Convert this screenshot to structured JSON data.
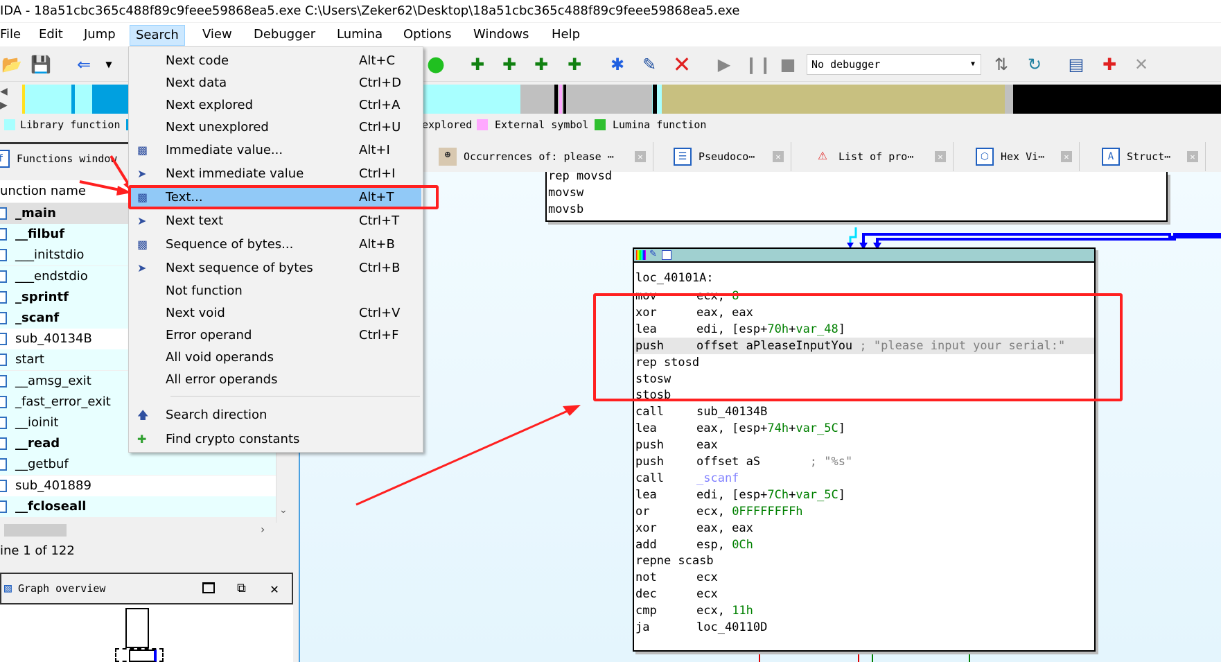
{
  "window": {
    "title": "IDA - 18a51cbc365c488f89c9feee59868ea5.exe C:\\Users\\Zeker62\\Desktop\\18a51cbc365c488f89c9feee59868ea5.exe"
  },
  "menubar": [
    "File",
    "Edit",
    "Jump",
    "Search",
    "View",
    "Debugger",
    "Lumina",
    "Options",
    "Windows",
    "Help"
  ],
  "toolbar": {
    "debugger_select": "No debugger"
  },
  "legend": {
    "library": "Library function",
    "unexplored": "explored",
    "external": "External symbol",
    "lumina": "Lumina function"
  },
  "colors": {
    "library": "#a8ffff",
    "regular": "#00a0e0",
    "external": "#ffa8ff",
    "lumina": "#30c030",
    "data": "#c8c080",
    "highlight_box": "#ff2020"
  },
  "tabs": {
    "functions": "Functions window",
    "occurrences": "Occurrences of: please ⋯",
    "pseudocode": "Pseudoco⋯",
    "problems": "List of pro⋯",
    "hexview": "Hex Vi⋯",
    "structures": "Struct⋯"
  },
  "functions": {
    "header": "unction name",
    "rows": [
      {
        "name": "_main",
        "bold": true
      },
      {
        "name": "__filbuf",
        "bold": true
      },
      {
        "name": "___initstdio",
        "bold": false
      },
      {
        "name": "___endstdio",
        "bold": false
      },
      {
        "name": "_sprintf",
        "bold": true
      },
      {
        "name": "_scanf",
        "bold": true
      },
      {
        "name": "sub_40134B",
        "bold": false
      },
      {
        "name": "start",
        "bold": false
      },
      {
        "name": "__amsg_exit",
        "bold": false
      },
      {
        "name": "_fast_error_exit",
        "bold": false
      },
      {
        "name": "__ioinit",
        "bold": false
      },
      {
        "name": "__read",
        "bold": true
      },
      {
        "name": "__getbuf",
        "bold": false
      },
      {
        "name": "sub_401889",
        "bold": false
      },
      {
        "name": "__fcloseall",
        "bold": true
      }
    ],
    "status": "ine 1 of 122"
  },
  "graph_overview": {
    "title": "Graph overview"
  },
  "search_menu": [
    {
      "label": "Next code",
      "shortcut": "Alt+C",
      "icon": ""
    },
    {
      "label": "Next data",
      "shortcut": "Ctrl+D",
      "icon": ""
    },
    {
      "label": "Next explored",
      "shortcut": "Ctrl+A",
      "icon": ""
    },
    {
      "label": "Next unexplored",
      "shortcut": "Ctrl+U",
      "icon": ""
    },
    {
      "label": "Immediate value...",
      "shortcut": "Alt+I",
      "icon": "binoculars-icon"
    },
    {
      "label": "Next immediate value",
      "shortcut": "Ctrl+I",
      "icon": "binoculars-next-icon"
    },
    {
      "label": "Text...",
      "shortcut": "Alt+T",
      "icon": "binoculars-text-icon"
    },
    {
      "label": "Next text",
      "shortcut": "Ctrl+T",
      "icon": "binoculars-next-icon"
    },
    {
      "label": "Sequence of bytes...",
      "shortcut": "Alt+B",
      "icon": "binoculars-bytes-icon"
    },
    {
      "label": "Next sequence of bytes",
      "shortcut": "Ctrl+B",
      "icon": "binoculars-next-icon"
    },
    {
      "label": "Not function",
      "shortcut": "",
      "icon": ""
    },
    {
      "label": "Next void",
      "shortcut": "Ctrl+V",
      "icon": ""
    },
    {
      "label": "Error operand",
      "shortcut": "Ctrl+F",
      "icon": ""
    },
    {
      "label": "All void operands",
      "shortcut": "",
      "icon": ""
    },
    {
      "label": "All error operands",
      "shortcut": "",
      "icon": ""
    },
    {
      "label": "Search direction",
      "shortcut": "",
      "icon": "arrow-up-icon"
    },
    {
      "label": "Find crypto constants",
      "shortcut": "",
      "icon": "crypto-icon"
    }
  ],
  "top_block": [
    "rep movsd",
    "movsw",
    "movsb"
  ],
  "main_block": {
    "label": "loc_40101A:",
    "lines": [
      {
        "mn": "mov",
        "op": [
          [
            "ecx, ",
            ""
          ],
          [
            "8",
            "g"
          ]
        ]
      },
      {
        "mn": "xor",
        "op": [
          [
            "eax, eax",
            ""
          ]
        ]
      },
      {
        "mn": "lea",
        "op": [
          [
            "edi, [esp+",
            ""
          ],
          [
            "70h",
            "g"
          ],
          [
            "+",
            ""
          ],
          [
            "var_48",
            "g"
          ],
          [
            "]",
            ""
          ]
        ]
      },
      {
        "mn": "push",
        "op": [
          [
            "offset aPleaseInputYou ",
            ""
          ],
          [
            "; \"please input your serial:\"",
            "gr"
          ]
        ]
      },
      {
        "mn": "rep stosd",
        "op": []
      },
      {
        "mn": "stosw",
        "op": []
      },
      {
        "mn": "stosb",
        "op": []
      },
      {
        "mn": "call",
        "op": [
          [
            "sub_40134B",
            ""
          ]
        ]
      },
      {
        "mn": "lea",
        "op": [
          [
            "eax, [esp+",
            ""
          ],
          [
            "74h",
            "g"
          ],
          [
            "+",
            ""
          ],
          [
            "var_5C",
            "g"
          ],
          [
            "]",
            ""
          ]
        ]
      },
      {
        "mn": "push",
        "op": [
          [
            "eax",
            ""
          ]
        ]
      },
      {
        "mn": "push",
        "op": [
          [
            "offset aS       ",
            ""
          ],
          [
            "; \"%s\"",
            "gr"
          ]
        ]
      },
      {
        "mn": "call",
        "op": [
          [
            "_scanf",
            "pu"
          ]
        ]
      },
      {
        "mn": "lea",
        "op": [
          [
            "edi, [esp+",
            ""
          ],
          [
            "7Ch",
            "g"
          ],
          [
            "+",
            ""
          ],
          [
            "var_5C",
            "g"
          ],
          [
            "]",
            ""
          ]
        ]
      },
      {
        "mn": "or",
        "op": [
          [
            "ecx, ",
            ""
          ],
          [
            "0FFFFFFFFh",
            "g"
          ]
        ]
      },
      {
        "mn": "xor",
        "op": [
          [
            "eax, eax",
            ""
          ]
        ]
      },
      {
        "mn": "add",
        "op": [
          [
            "esp, ",
            ""
          ],
          [
            "0Ch",
            "g"
          ]
        ]
      },
      {
        "mn": "repne scasb",
        "op": []
      },
      {
        "mn": "not",
        "op": [
          [
            "ecx",
            ""
          ]
        ]
      },
      {
        "mn": "dec",
        "op": [
          [
            "ecx",
            ""
          ]
        ]
      },
      {
        "mn": "cmp",
        "op": [
          [
            "ecx, ",
            ""
          ],
          [
            "11h",
            "g"
          ]
        ]
      },
      {
        "mn": "ja",
        "op": [
          [
            "loc_40110D",
            ""
          ]
        ]
      }
    ]
  }
}
